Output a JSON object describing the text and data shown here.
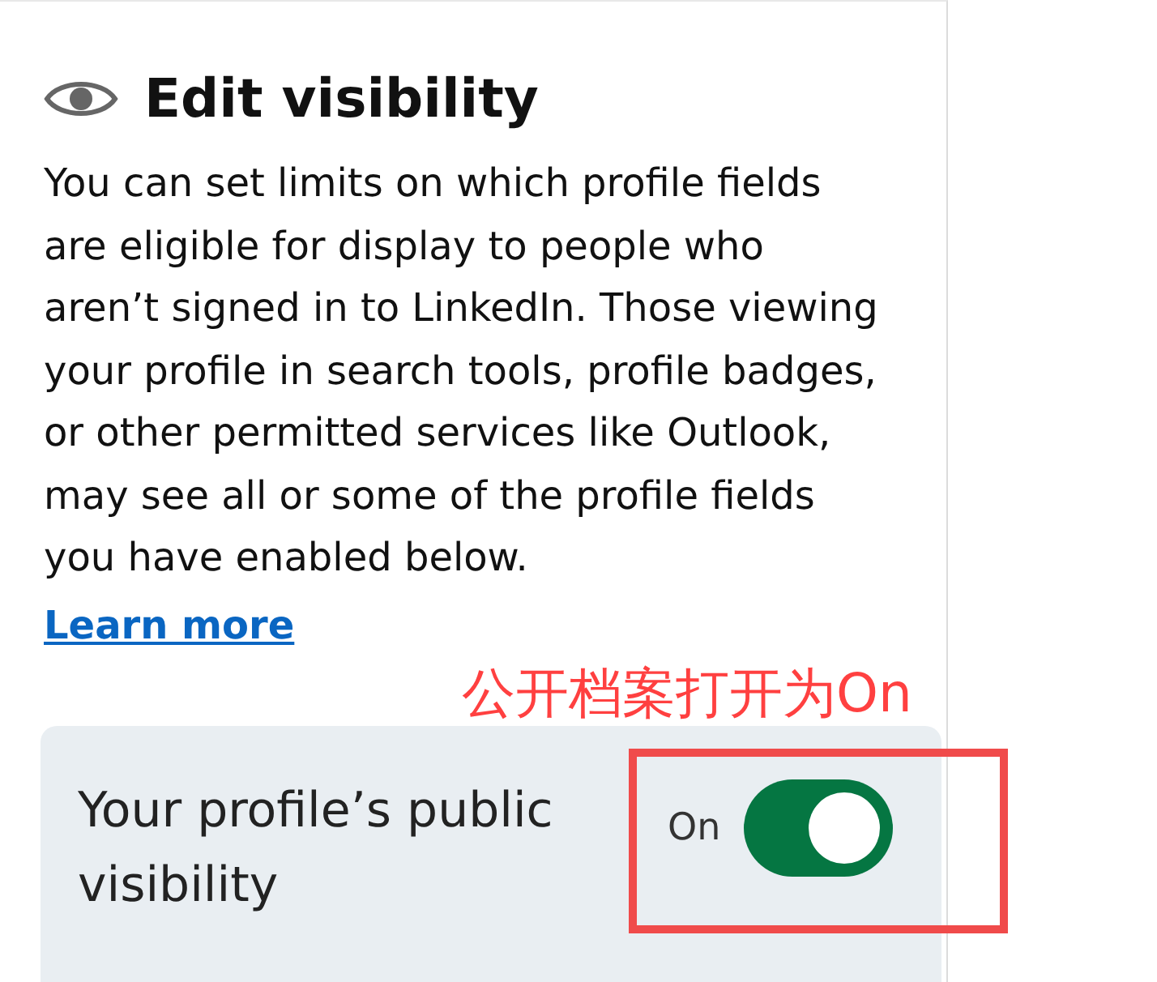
{
  "section": {
    "title": "Edit visibility",
    "description_lines": [
      "You can set limits on which profile fields",
      "are eligible for display to people who",
      "aren’t signed in to LinkedIn. Those viewing",
      "your profile in search tools, profile badges,",
      "or other permitted services like Outlook,",
      "may see all or some of the profile fields",
      "you have enabled below."
    ],
    "link": "Learn more"
  },
  "annotation": {
    "text": "公开档案打开为On"
  },
  "visibility_card": {
    "label": "Your profile’s public visibility",
    "state_label": "On",
    "on": true
  }
}
